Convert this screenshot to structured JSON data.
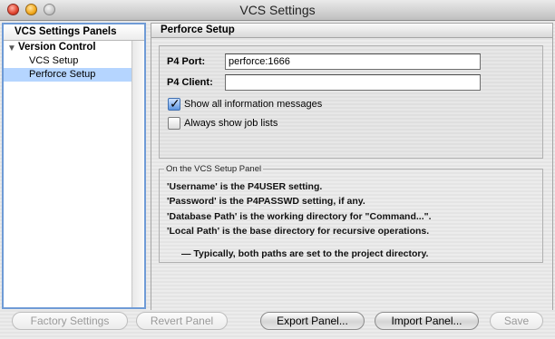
{
  "window": {
    "title": "VCS Settings"
  },
  "sidebar": {
    "header": "VCS Settings Panels",
    "group": {
      "label": "Version Control",
      "expanded": true
    },
    "items": [
      {
        "label": "VCS Setup",
        "selected": false
      },
      {
        "label": "Perforce Setup",
        "selected": true
      }
    ]
  },
  "panel": {
    "header": "Perforce Setup",
    "p4_port": {
      "label": "P4 Port:",
      "value": "perforce:1666"
    },
    "p4_client": {
      "label": "P4 Client:",
      "value": ""
    },
    "show_all_messages": {
      "label": "Show all information messages",
      "checked": true
    },
    "always_show_job_lists": {
      "label": "Always show job lists",
      "checked": false
    }
  },
  "info": {
    "legend": "On the VCS Setup Panel",
    "lines": [
      "'Username' is the P4USER setting.",
      "'Password' is the P4PASSWD setting, if any.",
      "'Database Path' is the working directory for \"Command...\".",
      "'Local Path' is the base directory for recursive operations."
    ],
    "note": "— Typically, both paths are set to the project directory."
  },
  "buttons": {
    "factory_settings": {
      "label": "Factory Settings",
      "enabled": false
    },
    "revert_panel": {
      "label": "Revert Panel",
      "enabled": false
    },
    "export_panel": {
      "label": "Export Panel...",
      "enabled": true
    },
    "import_panel": {
      "label": "Import Panel...",
      "enabled": true
    },
    "save": {
      "label": "Save",
      "enabled": false
    }
  },
  "colors": {
    "selection": "#b5d5ff",
    "focus_ring": "#6f9bd6",
    "close_button": "#e0442f",
    "minimize_button": "#f2a91c",
    "zoom_button": "#c9c9c9"
  }
}
